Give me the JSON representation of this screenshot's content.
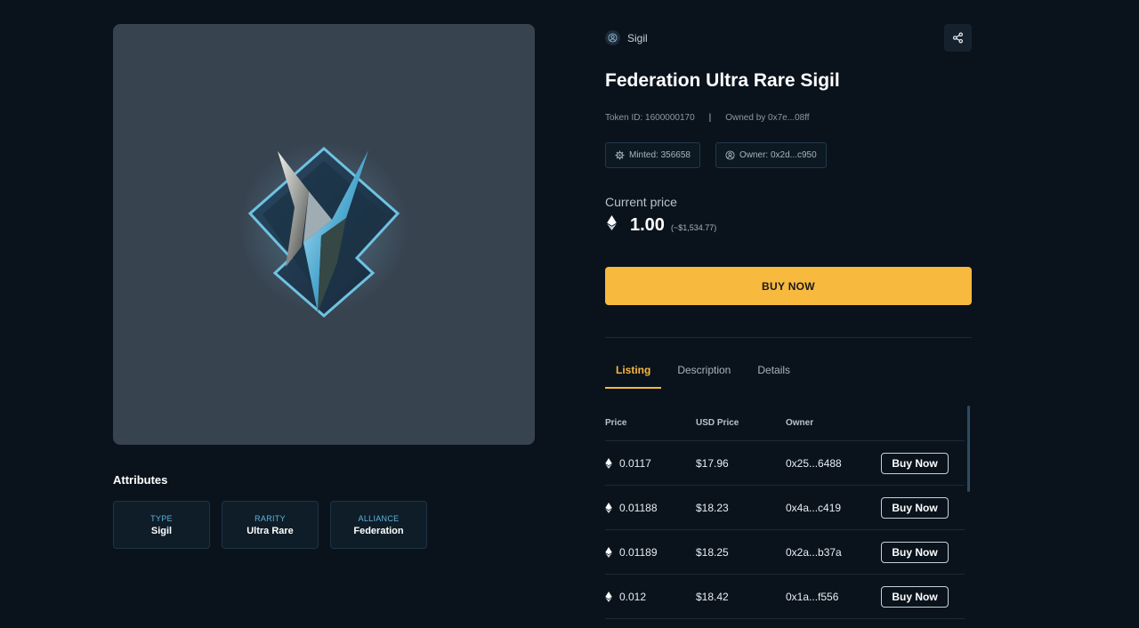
{
  "colors": {
    "background": "#0a131c",
    "accent": "#f7b93e",
    "art_background": "#384350",
    "attribute_key": "#5fb3dc"
  },
  "asset": {
    "category": "Sigil",
    "category_icon": "user-circle-icon",
    "title": "Federation Ultra Rare Sigil",
    "token_id": "Token ID: 1600000170",
    "separator": "|",
    "owned_by": "Owned by 0x7e...08ff",
    "minted": "Minted: 356658",
    "owner_chip": "Owner: 0x2d...c950"
  },
  "price": {
    "label": "Current price",
    "value": "1.00",
    "usd": "(~$1,534.77)",
    "buy_label": "BUY NOW"
  },
  "attributes": {
    "title": "Attributes",
    "items": [
      {
        "key": "TYPE",
        "value": "Sigil"
      },
      {
        "key": "RARITY",
        "value": "Ultra Rare"
      },
      {
        "key": "ALLIANCE",
        "value": "Federation"
      }
    ]
  },
  "tabs": [
    {
      "label": "Listing",
      "active": true
    },
    {
      "label": "Description",
      "active": false
    },
    {
      "label": "Details",
      "active": false
    }
  ],
  "listing": {
    "headers": [
      "Price",
      "USD Price",
      "Owner"
    ],
    "rows": [
      {
        "price": "0.0117",
        "usd": "$17.96",
        "owner": "0x25...6488",
        "action": "Buy Now"
      },
      {
        "price": "0.01188",
        "usd": "$18.23",
        "owner": "0x4a...c419",
        "action": "Buy Now"
      },
      {
        "price": "0.01189",
        "usd": "$18.25",
        "owner": "0x2a...b37a",
        "action": "Buy Now"
      },
      {
        "price": "0.012",
        "usd": "$18.42",
        "owner": "0x1a...f556",
        "action": "Buy Now"
      }
    ]
  }
}
